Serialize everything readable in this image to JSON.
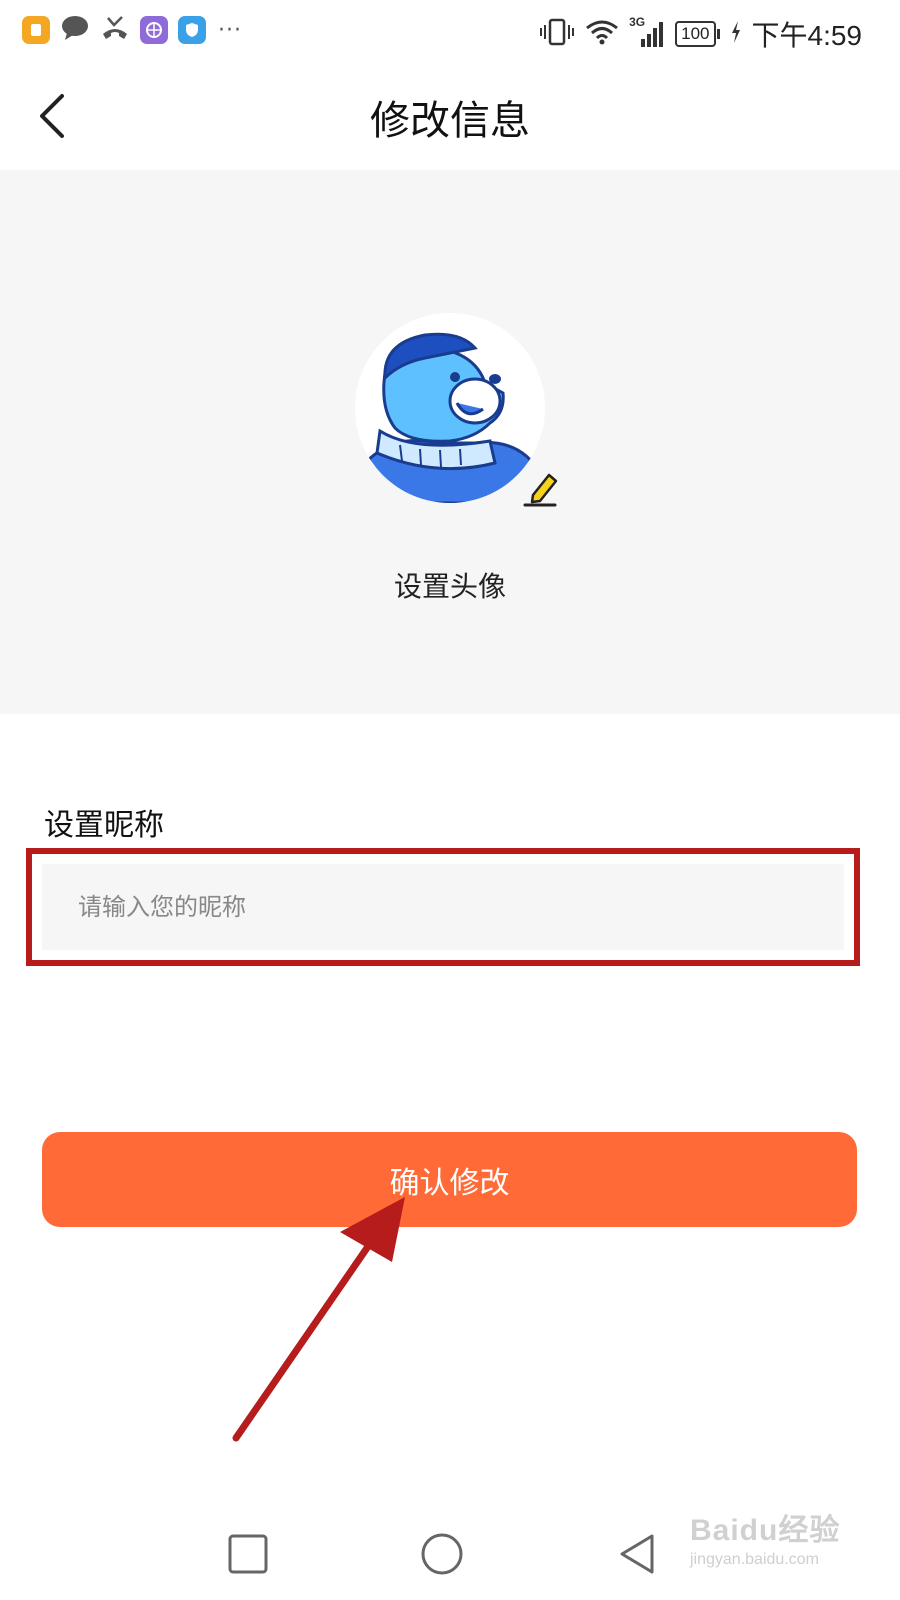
{
  "status_bar": {
    "dots": "···",
    "network": "3G",
    "battery": "100",
    "time": "下午4:59"
  },
  "header": {
    "title": "修改信息"
  },
  "avatar_section": {
    "label": "设置头像"
  },
  "nickname": {
    "label": "设置昵称",
    "placeholder": "请输入您的昵称",
    "value": ""
  },
  "confirm_button": {
    "label": "确认修改"
  },
  "colors": {
    "accent": "#ff6a36",
    "highlight": "#b71c1c",
    "section_bg": "#f6f6f6"
  },
  "watermark": {
    "main": "Baidu经验",
    "sub": "jingyan.baidu.com"
  }
}
